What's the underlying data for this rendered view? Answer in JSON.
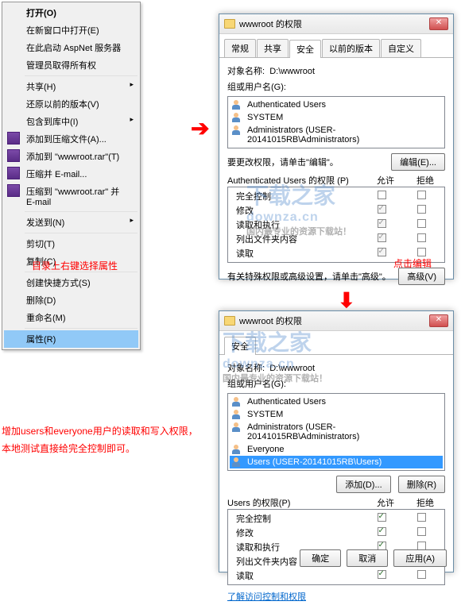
{
  "context_menu": {
    "items": [
      {
        "label": "打开(O)",
        "bold": true
      },
      {
        "label": "在新窗口中打开(E)"
      },
      {
        "label": "在此启动 AspNet 服务器"
      },
      {
        "label": "管理员取得所有权"
      },
      {
        "sep": true
      },
      {
        "label": "共享(H)",
        "arrow": true
      },
      {
        "label": "还原以前的版本(V)"
      },
      {
        "label": "包含到库中(I)",
        "arrow": true
      },
      {
        "label": "添加到压缩文件(A)...",
        "rar": true
      },
      {
        "label": "添加到 \"wwwroot.rar\"(T)",
        "rar": true
      },
      {
        "label": "压缩并 E-mail...",
        "rar": true
      },
      {
        "label": "压缩到 \"wwwroot.rar\" 并 E-mail",
        "rar": true
      },
      {
        "sep": true
      },
      {
        "label": "发送到(N)",
        "arrow": true
      },
      {
        "sep": true
      },
      {
        "label": "剪切(T)"
      },
      {
        "label": "复制(C)"
      },
      {
        "sep": true
      },
      {
        "label": "创建快捷方式(S)"
      },
      {
        "label": "删除(D)"
      },
      {
        "label": "重命名(M)"
      },
      {
        "sep": true
      },
      {
        "label": "属性(R)",
        "highlight": true
      }
    ]
  },
  "dialog1": {
    "title": "wwwroot 的权限",
    "tabs": [
      "常规",
      "共享",
      "安全",
      "以前的版本",
      "自定义"
    ],
    "active_tab": 2,
    "object_label": "对象名称:",
    "object_value": "D:\\wwwroot",
    "group_label": "组或用户名(G):",
    "users": [
      {
        "name": "Authenticated Users"
      },
      {
        "name": "SYSTEM"
      },
      {
        "name": "Administrators (USER-20141015RB\\Administrators)"
      }
    ],
    "edit_hint": "要更改权限，请单击\"编辑\"。",
    "edit_btn": "编辑(E)...",
    "perm_label": "Authenticated Users 的权限 (P)",
    "allow": "允许",
    "deny": "拒绝",
    "perms": [
      {
        "n": "完全控制",
        "a": false,
        "d": false,
        "ro": true
      },
      {
        "n": "修改",
        "a": true,
        "d": false,
        "ro": true
      },
      {
        "n": "读取和执行",
        "a": true,
        "d": false,
        "ro": true
      },
      {
        "n": "列出文件夹内容",
        "a": true,
        "d": false,
        "ro": true
      },
      {
        "n": "读取",
        "a": true,
        "d": false,
        "ro": true
      }
    ],
    "adv_hint": "有关特殊权限或高级设置，请单击\"高级\"。",
    "adv_btn": "高级(V)"
  },
  "dialog2": {
    "title": "wwwroot 的权限",
    "tabs": [
      "安全"
    ],
    "object_label": "对象名称:",
    "object_value": "D:\\wwwroot",
    "group_label": "组或用户名(G):",
    "users": [
      {
        "name": "Authenticated Users"
      },
      {
        "name": "SYSTEM"
      },
      {
        "name": "Administrators (USER-20141015RB\\Administrators)"
      },
      {
        "name": "Everyone"
      },
      {
        "name": "Users (USER-20141015RB\\Users)",
        "sel": true
      }
    ],
    "add_btn": "添加(D)...",
    "remove_btn": "删除(R)",
    "perm_label": "Users 的权限(P)",
    "allow": "允许",
    "deny": "拒绝",
    "perms": [
      {
        "n": "完全控制",
        "a": true,
        "d": false
      },
      {
        "n": "修改",
        "a": true,
        "d": false
      },
      {
        "n": "读取和执行",
        "a": true,
        "d": false
      },
      {
        "n": "列出文件夹内容",
        "a": true,
        "d": false
      },
      {
        "n": "读取",
        "a": true,
        "d": false
      }
    ],
    "link": "了解访问控制和权限",
    "ok": "确定",
    "cancel": "取消",
    "apply": "应用(A)"
  },
  "annotations": {
    "a1": "目录上右键选择属性",
    "a2": "增加users和everyone用户的读取和写入权限，本地测试直接给完全控制即可。",
    "a3": "点击编辑"
  },
  "watermark": {
    "big": "下载之家",
    "url": "downza.cn",
    "tag": "国内最专业的资源下载站！"
  }
}
